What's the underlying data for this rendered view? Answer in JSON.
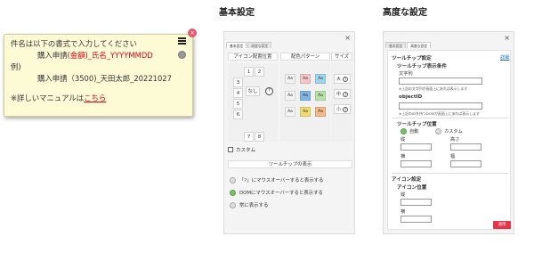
{
  "tooltip_preview": {
    "line1": "件名は以下の書式で入力してください",
    "line2_prefix": "購入申請",
    "line2_red": "(金額)_氏名_YYYYMMDD",
    "line3": "例)",
    "line4": "購入申請（3500)_天田太郎_20221027",
    "note_prefix": "※詳しいマニュアルは",
    "note_link": "こちら",
    "close_glyph": "×"
  },
  "basic_settings": {
    "heading": "基本設定",
    "tabs": [
      "基本設定",
      "高度な設定"
    ],
    "close_glyph": "×",
    "col_icon_position": "アイコン配置位置",
    "col_color_pattern": "配色パターン",
    "col_size": "サイズ",
    "numpad": {
      "k1": "1",
      "k2": "2",
      "k3": "3",
      "k4": "4",
      "k5": "5",
      "k6": "6",
      "k7": "7",
      "k8": "8",
      "none": "なし",
      "q": "?"
    },
    "swatch_label": "Aa",
    "sizes": {
      "large": "大",
      "medium": "中",
      "small": "小",
      "q": "?"
    },
    "custom_label": "カスタム",
    "tooltip_display_head": "ツールチップの表示",
    "radio_options": [
      "「?」にマウスオーバーすると表示する",
      "DOMにマウスオーバーすると表示する",
      "常に表示する"
    ],
    "radio_states": [
      false,
      true,
      false
    ]
  },
  "advanced_settings": {
    "heading": "高度な設定",
    "tabs": [
      "基本設定",
      "高度な設定"
    ],
    "close_glyph": "×",
    "section_tooltip": "ツールチップ設定",
    "detail_link": "詳細",
    "display_condition": "ツールチップ表示条件",
    "text_label": "文字列",
    "text_note": "※上記の文字列が画面上にあれば表示します",
    "objectid_label": "objectID",
    "objectid_note": "※上記のIDを持つDOMが画面上にあれば表示します",
    "tooltip_position": "ツールチップ位置",
    "auto_label": "自動",
    "custom_label": "カスタム",
    "vertical_label": "縦",
    "height_label": "高さ",
    "horizontal_label": "横",
    "width_label": "幅",
    "icon_settings": "アイコン設定",
    "icon_position": "アイコン位置",
    "icon_vertical": "縦",
    "icon_horizontal": "横",
    "apply_button": "適用"
  },
  "colors": {
    "tooltip_bg": "#fdfbd6",
    "accent_red": "#e60012",
    "apply_red": "#e8334a",
    "radio_on": "#79c267",
    "link_blue": "#1b6fd1",
    "swatches": [
      "#f2f2f2",
      "#f7c6cc",
      "#9fd6ee",
      "#f4f4f4",
      "#7fb6e8",
      "#b7e3a9",
      "#f4f4f4",
      "#f1dc6e",
      "#f3b989"
    ]
  }
}
